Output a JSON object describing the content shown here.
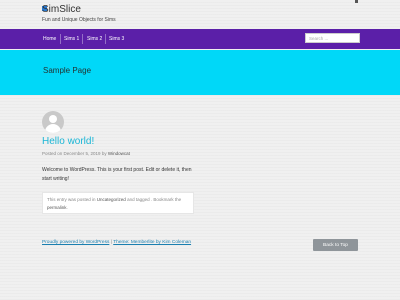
{
  "site": {
    "title": "SimSlice",
    "tagline": "Fun and Unique Objects for Sims"
  },
  "nav": {
    "items": [
      {
        "label": "Home"
      },
      {
        "label": "Sims 1"
      },
      {
        "label": "Sims 2"
      },
      {
        "label": "Sims 3"
      }
    ],
    "search_placeholder": "Search ..."
  },
  "banner": {
    "title": "Sample Page"
  },
  "post": {
    "title": "Hello world!",
    "meta_prefix": "Posted on",
    "date": "December 5, 2019",
    "by": "by",
    "author": "Windowcat",
    "content": "Welcome to WordPress. This is your first post. Edit or delete it, then start writing!"
  },
  "entry_meta": {
    "prefix": "This entry was posted in",
    "category": "Uncategorized",
    "middle": "and tagged . Bookmark the",
    "permalink": "permalink",
    "suffix": "."
  },
  "footer": {
    "powered": "Proudly powered by WordPress",
    "separator": "|",
    "theme": "Theme: Memberlite by Kim Coleman",
    "back_to_top": "Back to Top"
  },
  "colors": {
    "nav_bg": "#5b1fa8",
    "banner_bg": "#00d8f8",
    "title_link": "#1ab6d6",
    "footer_link": "#1a7fb0",
    "back_to_top_bg": "#8f959a"
  }
}
